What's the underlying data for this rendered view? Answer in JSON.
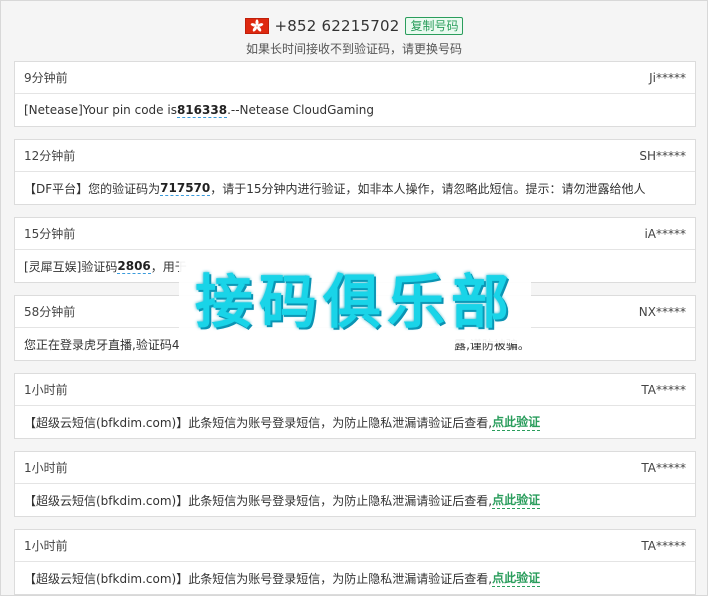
{
  "header": {
    "flag_icon": "hong-kong-flag-icon",
    "phone": "+852 62215702",
    "copy_label": "复制号码",
    "tip": "如果长时间接收不到验证码，请更换号码"
  },
  "messages": [
    {
      "time": "9分钟前",
      "sender": "Ji*****",
      "pre": "[Netease]Your pin code is ",
      "code": "816338",
      "post": ".--Netease CloudGaming",
      "link": ""
    },
    {
      "time": "12分钟前",
      "sender": "SH*****",
      "pre": "【DF平台】您的验证码为",
      "code": "717570",
      "post": "，请于15分钟内进行验证，如非本人操作，请忽略此短信。提示：请勿泄露给他人",
      "link": ""
    },
    {
      "time": "15分钟前",
      "sender": "iA*****",
      "pre": "[灵犀互娱]验证码",
      "code": "2806",
      "post": "，用于",
      "link": ""
    },
    {
      "time": "58分钟前",
      "sender": "NX*****",
      "pre": "您正在登录虎牙直播,验证码4",
      "code": "",
      "post": "                                                                        露,谨防被骗。",
      "link": ""
    },
    {
      "time": "1小时前",
      "sender": "TA*****",
      "pre": "【超级云短信(bfkdim.com)】此条短信为账号登录短信，为防止隐私泄漏请验证后查看,",
      "code": "",
      "post": "",
      "link": "点此验证"
    },
    {
      "time": "1小时前",
      "sender": "TA*****",
      "pre": "【超级云短信(bfkdim.com)】此条短信为账号登录短信，为防止隐私泄漏请验证后查看,",
      "code": "",
      "post": "",
      "link": "点此验证"
    },
    {
      "time": "1小时前",
      "sender": "TA*****",
      "pre": "【超级云短信(bfkdim.com)】此条短信为账号登录短信，为防止隐私泄漏请验证后查看,",
      "code": "",
      "post": "",
      "link": "点此验证"
    }
  ],
  "watermark": {
    "text": "接码俱乐部"
  },
  "colors": {
    "accent_green": "#2a9d5c",
    "flag_red": "#de2910",
    "watermark_cyan": "#19d4e8"
  }
}
